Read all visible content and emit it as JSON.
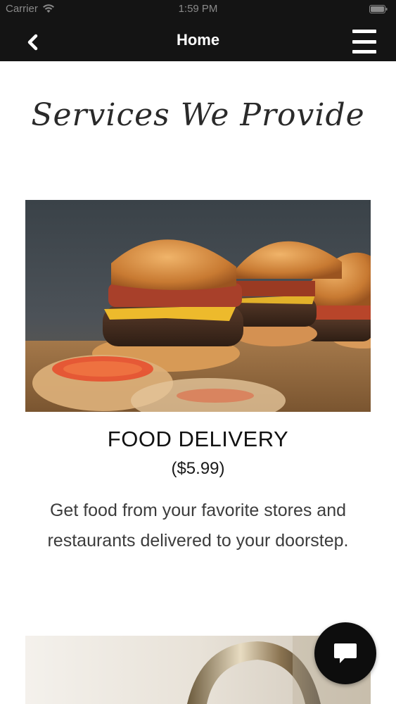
{
  "status_bar": {
    "carrier": "Carrier",
    "time": "1:59 PM"
  },
  "nav": {
    "title": "Home",
    "back_icon": "chevron-left-icon",
    "menu_icon": "hamburger-menu-icon"
  },
  "content": {
    "heading": "Services We Provide",
    "services": [
      {
        "title": "FOOD DELIVERY",
        "price": "($5.99)",
        "description": "Get food from your favorite stores and restaurants delivered to your doorstep."
      }
    ]
  },
  "chat_button": {
    "icon": "chat-bubble-icon"
  }
}
